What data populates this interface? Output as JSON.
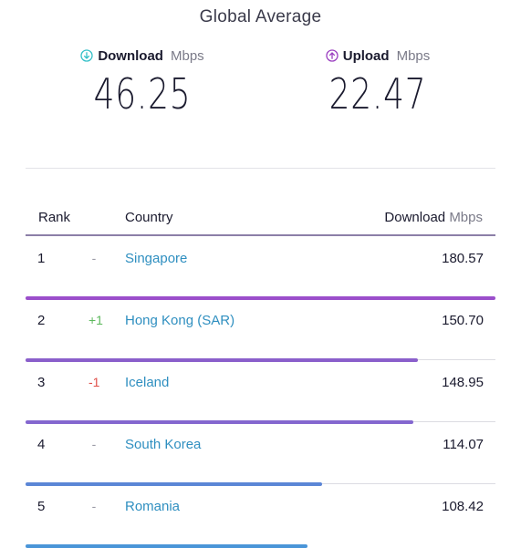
{
  "header": {
    "title": "Global Average"
  },
  "metrics": {
    "download": {
      "label": "Download",
      "unit": "Mbps",
      "value": "46.25",
      "icon": "download-arrow-icon",
      "color": "#35c0c8"
    },
    "upload": {
      "label": "Upload",
      "unit": "Mbps",
      "value": "22.47",
      "icon": "upload-arrow-icon",
      "color": "#9b3fc0"
    }
  },
  "table": {
    "headers": {
      "rank": "Rank",
      "country": "Country",
      "download": "Download",
      "unit": "Mbps"
    },
    "rows": [
      {
        "rank": "1",
        "change": "-",
        "change_status": "neutral",
        "country": "Singapore",
        "download": "180.57",
        "bar_fraction": 1.0,
        "bar_color": "#9b4fcb"
      },
      {
        "rank": "2",
        "change": "+1",
        "change_status": "up",
        "country": "Hong Kong (SAR)",
        "download": "150.70",
        "bar_fraction": 0.834,
        "bar_color": "#8a5fcb"
      },
      {
        "rank": "3",
        "change": "-1",
        "change_status": "down",
        "country": "Iceland",
        "download": "148.95",
        "bar_fraction": 0.825,
        "bar_color": "#8467cf"
      },
      {
        "rank": "4",
        "change": "-",
        "change_status": "neutral",
        "country": "South Korea",
        "download": "114.07",
        "bar_fraction": 0.632,
        "bar_color": "#5b86d6"
      },
      {
        "rank": "5",
        "change": "-",
        "change_status": "neutral",
        "country": "Romania",
        "download": "108.42",
        "bar_fraction": 0.6,
        "bar_color": "#4a95d8"
      }
    ]
  },
  "colors": {
    "up": "#5cb85c",
    "down": "#e0504a",
    "neutral": "#9a9aa6",
    "link": "#2f8fc0"
  }
}
